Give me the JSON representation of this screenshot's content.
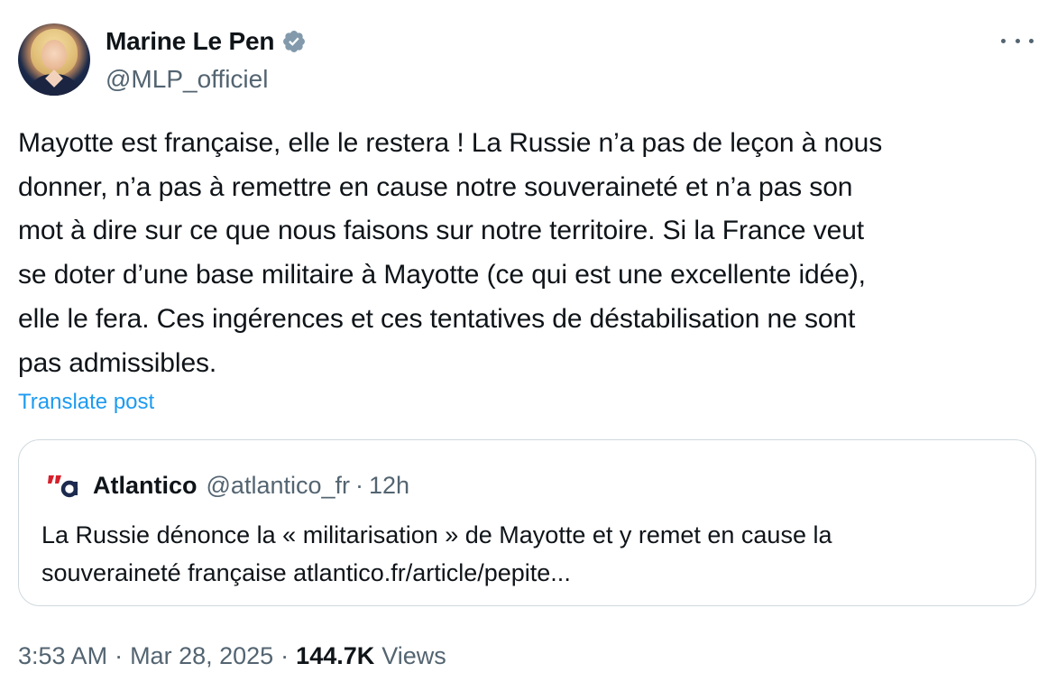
{
  "author": {
    "display_name": "Marine Le Pen",
    "handle": "@MLP_officiel",
    "verified_color": "#829aab"
  },
  "post": {
    "lines": [
      "Mayotte est française, elle le restera ! La Russie n’a pas de leçon à nous",
      "donner, n’a pas à remettre en cause notre souveraineté et n’a pas son",
      "mot à dire sur ce que nous faisons sur notre territoire. Si la France veut",
      "se doter d’une base militaire à Mayotte (ce qui est une excellente idée),",
      "elle le fera. Ces ingérences et ces tentatives de déstabilisation ne sont",
      "pas admissibles."
    ],
    "translate_label": "Translate post"
  },
  "quote": {
    "source_name": "Atlantico",
    "source_handle": "@atlantico_fr",
    "separator": "·",
    "time": "12h",
    "lines": [
      "La Russie dénonce la « militarisation » de Mayotte et y remet en cause la",
      "souveraineté française atlantico.fr/article/pepite..."
    ]
  },
  "meta": {
    "time": "3:53 AM",
    "separator": "·",
    "date": "Mar 28, 2025",
    "views_count": "144.7K",
    "views_label": "Views"
  },
  "colors": {
    "text": "#0f1419",
    "secondary": "#536471",
    "link": "#1d9bf0",
    "border": "#cfd9de",
    "atlantico_red": "#d6202c",
    "atlantico_navy": "#1d2a4f"
  },
  "icons": {
    "verified": "verified-badge-icon",
    "more": "more-options-icon",
    "quote_logo": "atlantico-logo-icon"
  }
}
